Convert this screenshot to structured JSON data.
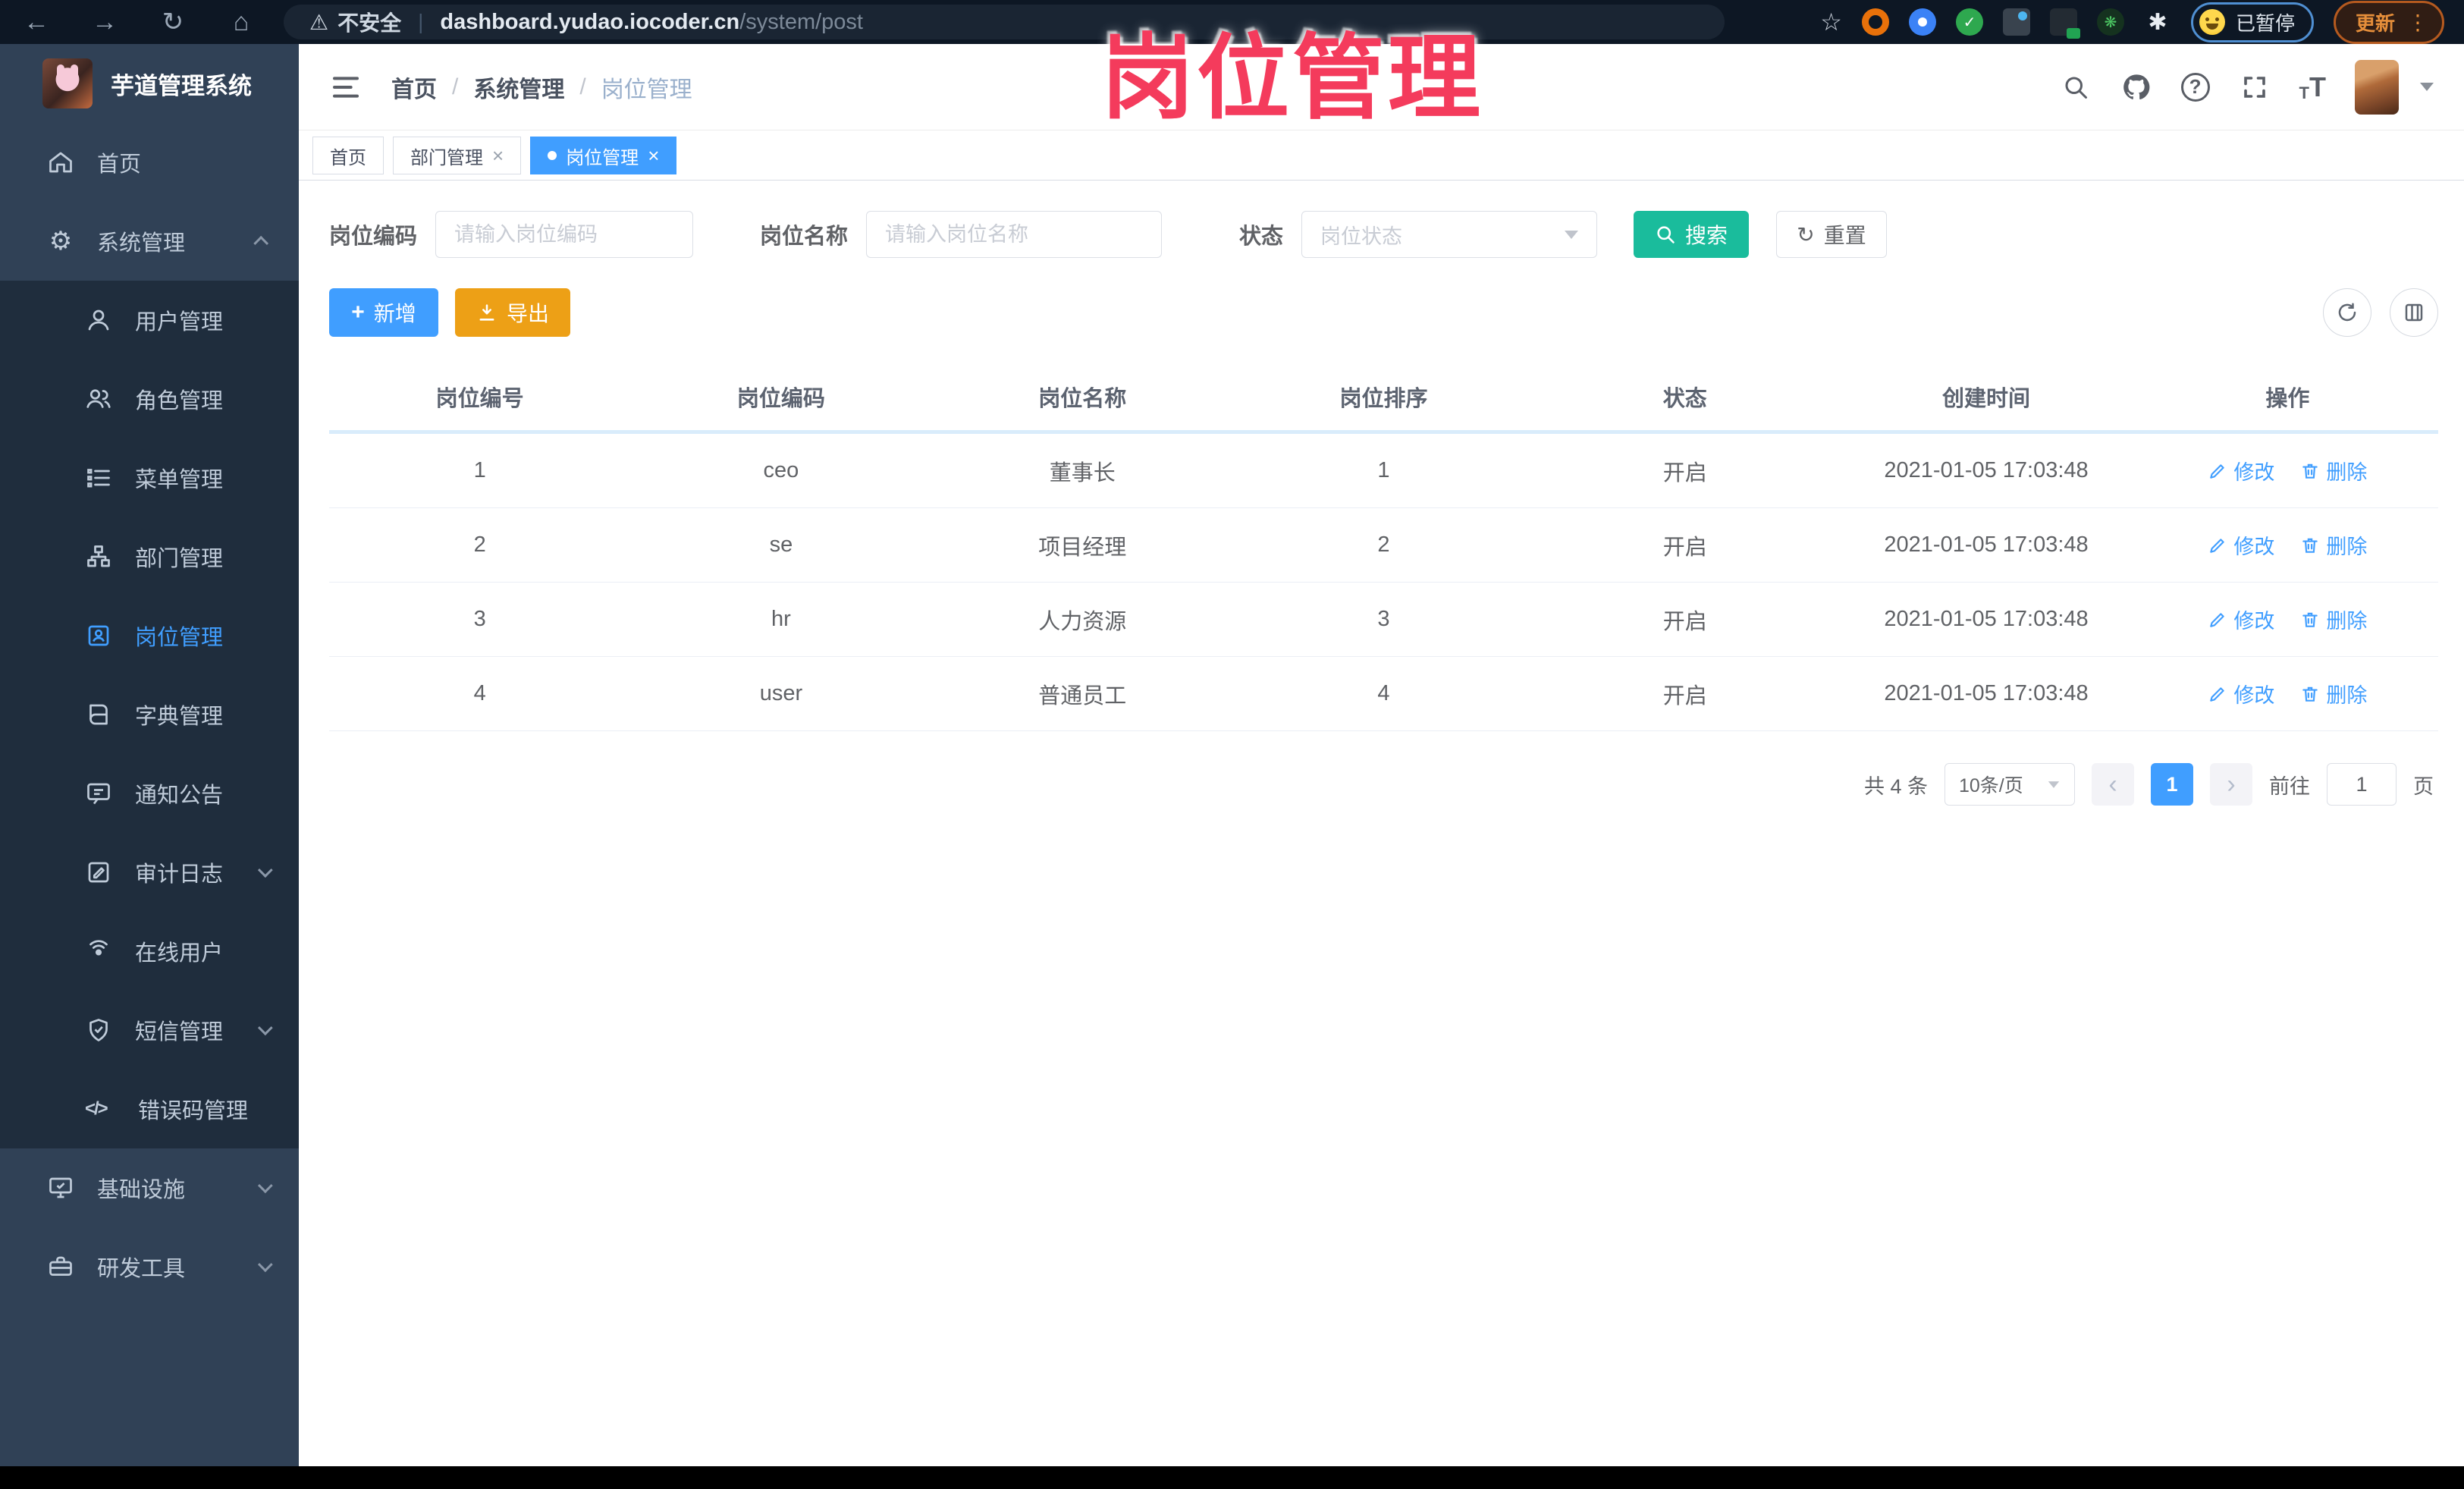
{
  "browser": {
    "security_label": "不安全",
    "url_host": "dashboard.yudao.iocoder.cn",
    "url_path": "/system/post",
    "profile_status": "已暂停",
    "update_label": "更新"
  },
  "annotation": {
    "text": "岗位管理",
    "color": "#f43b5c"
  },
  "icons": {
    "back": "←",
    "forward": "→",
    "reload": "↻",
    "home": "⌂",
    "warning": "⚠",
    "divider": "|",
    "star": "☆",
    "kebab": "⋮",
    "gear": "⚙",
    "question": "?",
    "close": "×",
    "plus": "+",
    "reset": "↻",
    "prev": "‹",
    "next": "›",
    "code": "</>",
    "puzzle": "✱",
    "sprout": "❋",
    "check": "✓",
    "font_big": "T",
    "font_small": "T"
  },
  "sidebar": {
    "app_title": "芋道管理系统",
    "top_items": [
      {
        "label": "首页"
      },
      {
        "label": "系统管理"
      }
    ],
    "submenu_items": [
      {
        "label": "用户管理"
      },
      {
        "label": "角色管理"
      },
      {
        "label": "菜单管理"
      },
      {
        "label": "部门管理"
      },
      {
        "label": "岗位管理"
      },
      {
        "label": "字典管理"
      },
      {
        "label": "通知公告"
      },
      {
        "label": "审计日志"
      },
      {
        "label": "在线用户"
      },
      {
        "label": "短信管理"
      },
      {
        "label": "错误码管理"
      }
    ],
    "bottom_items": [
      {
        "label": "基础设施"
      },
      {
        "label": "研发工具"
      }
    ]
  },
  "header": {
    "breadcrumb": [
      "首页",
      "系统管理",
      "岗位管理"
    ],
    "separator": "/"
  },
  "tabs": [
    {
      "label": "首页"
    },
    {
      "label": "部门管理"
    },
    {
      "label": "岗位管理"
    }
  ],
  "filters": {
    "post_code_label": "岗位编码",
    "post_code_placeholder": "请输入岗位编码",
    "post_name_label": "岗位名称",
    "post_name_placeholder": "请输入岗位名称",
    "status_label": "状态",
    "status_placeholder": "岗位状态",
    "search_label": "搜索",
    "reset_label": "重置"
  },
  "toolbar": {
    "add_label": "新增",
    "export_label": "导出"
  },
  "table": {
    "columns": [
      "岗位编号",
      "岗位编码",
      "岗位名称",
      "岗位排序",
      "状态",
      "创建时间",
      "操作"
    ],
    "edit_label": "修改",
    "delete_label": "删除",
    "rows": [
      {
        "id": "1",
        "code": "ceo",
        "name": "董事长",
        "sort": "1",
        "status": "开启",
        "created": "2021-01-05 17:03:48"
      },
      {
        "id": "2",
        "code": "se",
        "name": "项目经理",
        "sort": "2",
        "status": "开启",
        "created": "2021-01-05 17:03:48"
      },
      {
        "id": "3",
        "code": "hr",
        "name": "人力资源",
        "sort": "3",
        "status": "开启",
        "created": "2021-01-05 17:03:48"
      },
      {
        "id": "4",
        "code": "user",
        "name": "普通员工",
        "sort": "4",
        "status": "开启",
        "created": "2021-01-05 17:03:48"
      }
    ]
  },
  "pagination": {
    "total_text": "共 4 条",
    "page_size": "10条/页",
    "current_page": "1",
    "goto_label": "前往",
    "goto_value": "1",
    "page_suffix": "页"
  },
  "colors": {
    "accent_blue": "#409eff",
    "search_teal": "#1abc9c",
    "export_orange": "#eda016",
    "annotation_pink": "#f43b5c",
    "sidebar_bg": "#304156",
    "submenu_bg": "#1f2d3d"
  }
}
